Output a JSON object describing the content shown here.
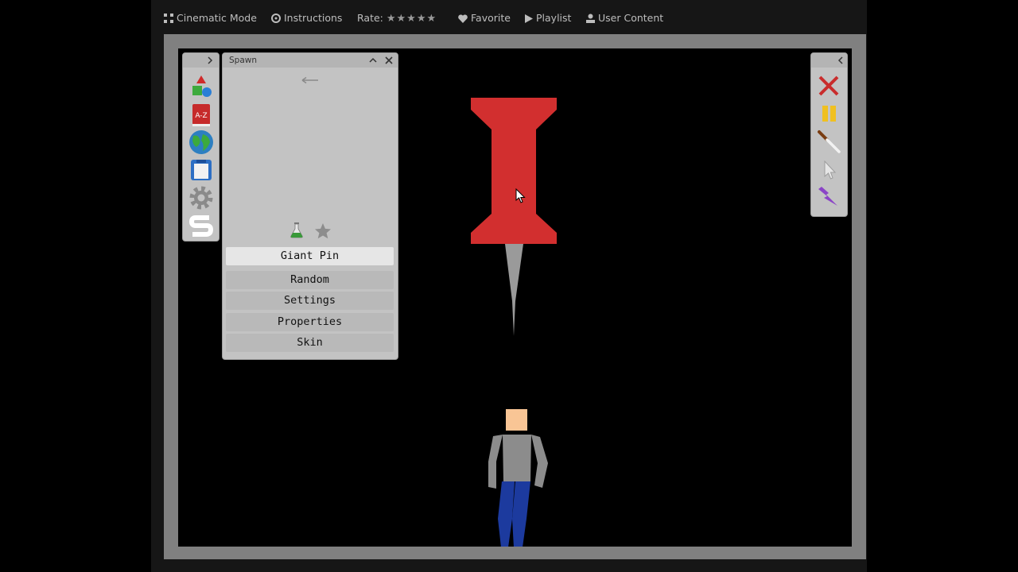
{
  "top_menu": {
    "cinematic": "Cinematic Mode",
    "instructions": "Instructions",
    "rate": "Rate:",
    "rate_stars": "★★★★★",
    "favorite": "Favorite",
    "playlist": "Playlist",
    "user_content": "User Content"
  },
  "spawn_panel": {
    "title": "Spawn",
    "selected_item": "Giant Pin",
    "options": [
      "Random",
      "Settings",
      "Properties",
      "Skin"
    ]
  },
  "left_toolbar": {
    "tools": [
      "shapes-icon",
      "a-z-icon",
      "globe-icon",
      "save-icon",
      "gear-icon",
      "s-icon"
    ]
  },
  "right_toolbar": {
    "tools": [
      "close-icon",
      "pause-icon",
      "knife-icon",
      "cursor-icon",
      "lightning-icon"
    ]
  },
  "colors": {
    "pin_red": "#d22f2f",
    "pin_needle": "#9a9a9a",
    "shirt": "#8c8c8c",
    "pants": "#1c3a9e",
    "skin": "#f9c595",
    "frame": "#808080"
  }
}
